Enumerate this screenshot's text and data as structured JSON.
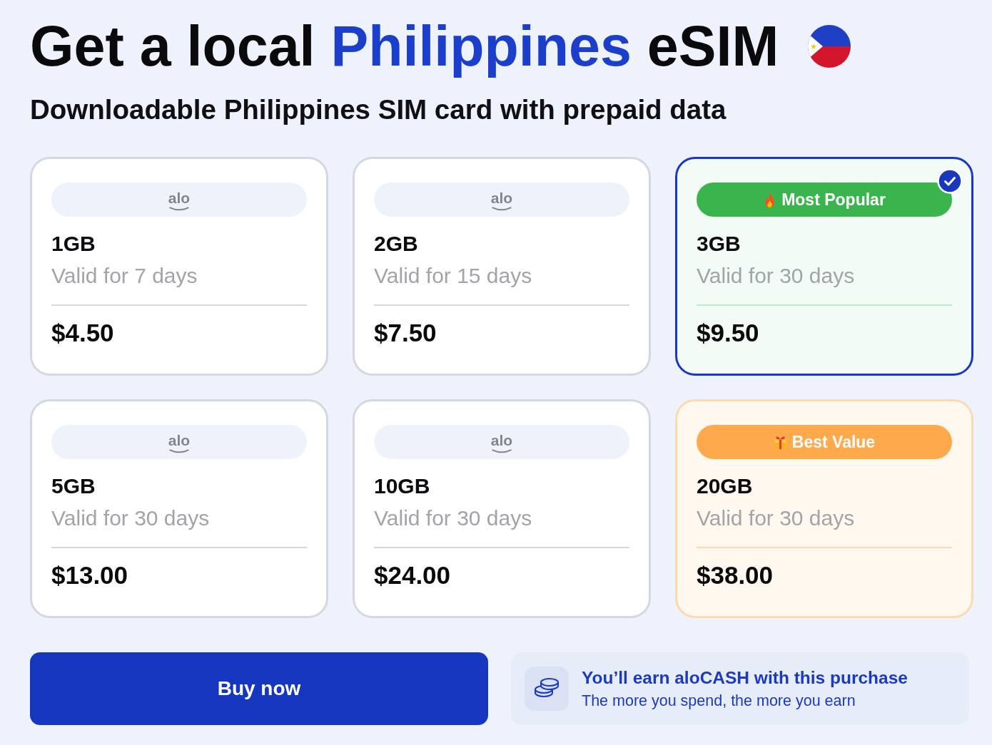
{
  "header": {
    "title": [
      {
        "text": "Get a local",
        "highlight": false
      },
      {
        "text": "Philippines",
        "highlight": true
      },
      {
        "text": "eSIM",
        "highlight": false
      }
    ],
    "subtitle": "Downloadable Philippines SIM card with prepaid data"
  },
  "plans": [
    {
      "badge": {
        "kind": "logo",
        "text": "alo"
      },
      "data": "1GB",
      "validity": "Valid for 7 days",
      "price": "$4.50",
      "selected": false
    },
    {
      "badge": {
        "kind": "logo",
        "text": "alo"
      },
      "data": "2GB",
      "validity": "Valid for 15 days",
      "price": "$7.50",
      "selected": false
    },
    {
      "badge": {
        "kind": "popular",
        "text": "Most Popular"
      },
      "data": "3GB",
      "validity": "Valid for 30 days",
      "price": "$9.50",
      "selected": true
    },
    {
      "badge": {
        "kind": "logo",
        "text": "alo"
      },
      "data": "5GB",
      "validity": "Valid for 30 days",
      "price": "$13.00",
      "selected": false
    },
    {
      "badge": {
        "kind": "logo",
        "text": "alo"
      },
      "data": "10GB",
      "validity": "Valid for 30 days",
      "price": "$24.00",
      "selected": false
    },
    {
      "badge": {
        "kind": "best_value",
        "text": "Best Value"
      },
      "data": "20GB",
      "validity": "Valid for 30 days",
      "price": "$38.00",
      "selected": false
    }
  ],
  "buy_button": {
    "label": "Buy now"
  },
  "reward": {
    "title": "You’ll earn aloCASH with this purchase",
    "subtitle": "The more you spend, the more you earn"
  }
}
